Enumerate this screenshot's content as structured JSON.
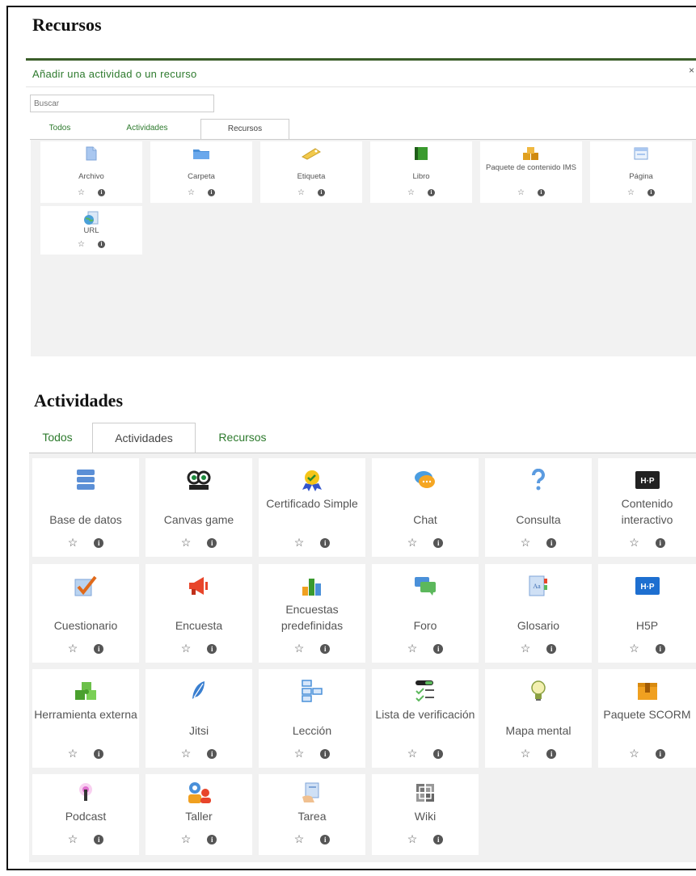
{
  "section1_title": "Recursos",
  "modal": {
    "title": "Añadir una actividad o un recurso",
    "close": "×",
    "search_placeholder": "Buscar",
    "tabs": [
      "Todos",
      "Actividades",
      "Recursos"
    ],
    "items": [
      {
        "label": "Archivo",
        "icon": "file-icon"
      },
      {
        "label": "Carpeta",
        "icon": "folder-icon"
      },
      {
        "label": "Etiqueta",
        "icon": "label-icon"
      },
      {
        "label": "Libro",
        "icon": "book-icon"
      },
      {
        "label": "Paquete de contenido IMS",
        "icon": "ims-package-icon"
      },
      {
        "label": "Página",
        "icon": "page-icon"
      },
      {
        "label": "URL",
        "icon": "url-icon"
      }
    ]
  },
  "section2_title": "Actividades",
  "activities": {
    "tabs": [
      "Todos",
      "Actividades",
      "Recursos"
    ],
    "items": [
      {
        "label": "Base de datos",
        "icon": "database-icon"
      },
      {
        "label": "Canvas game",
        "icon": "canvas-game-icon"
      },
      {
        "label": "Certificado Simple",
        "icon": "certificate-icon"
      },
      {
        "label": "Chat",
        "icon": "chat-icon"
      },
      {
        "label": "Consulta",
        "icon": "question-icon"
      },
      {
        "label": "Contenido interactivo",
        "icon": "h5p-icon"
      },
      {
        "label": "Cuestionario",
        "icon": "quiz-icon"
      },
      {
        "label": "Encuesta",
        "icon": "megaphone-icon"
      },
      {
        "label": "Encuestas predefinidas",
        "icon": "bar-chart-icon"
      },
      {
        "label": "Foro",
        "icon": "forum-icon"
      },
      {
        "label": "Glosario",
        "icon": "glossary-icon"
      },
      {
        "label": "H5P",
        "icon": "h5p-icon"
      },
      {
        "label": "Herramienta externa",
        "icon": "puzzle-icon"
      },
      {
        "label": "Jitsi",
        "icon": "jitsi-icon"
      },
      {
        "label": "Lección",
        "icon": "lesson-icon"
      },
      {
        "label": "Lista de verificación",
        "icon": "checklist-icon"
      },
      {
        "label": "Mapa mental",
        "icon": "lightbulb-icon"
      },
      {
        "label": "Paquete SCORM",
        "icon": "scorm-icon"
      },
      {
        "label": "Podcast",
        "icon": "podcast-icon"
      },
      {
        "label": "Taller",
        "icon": "workshop-icon"
      },
      {
        "label": "Tarea",
        "icon": "assignment-icon"
      },
      {
        "label": "Wiki",
        "icon": "wiki-icon"
      }
    ]
  },
  "star_glyph": "☆",
  "info_glyph": "i"
}
